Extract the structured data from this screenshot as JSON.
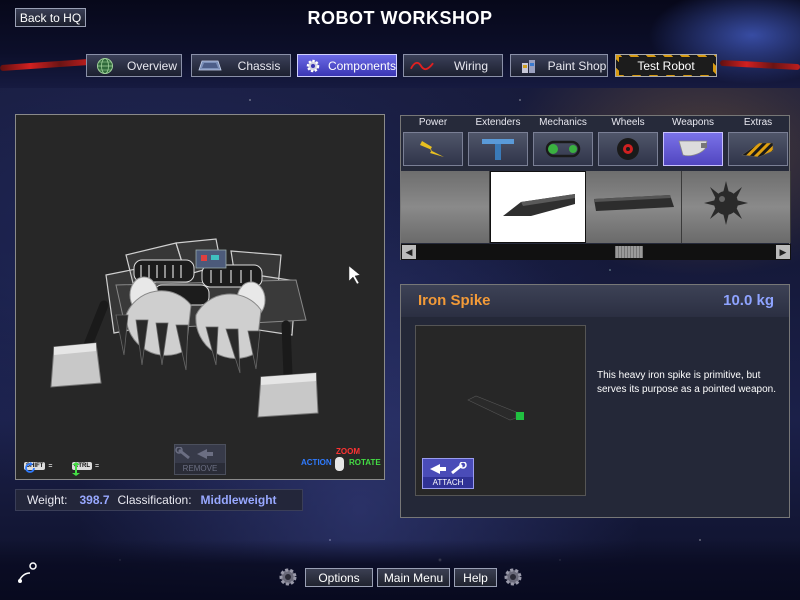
{
  "header": {
    "title": "ROBOT WORKSHOP",
    "back_label": "Back to HQ"
  },
  "tabs": [
    {
      "label": "Overview",
      "icon": "globe-icon",
      "active": false
    },
    {
      "label": "Chassis",
      "icon": "chassis-icon",
      "active": false
    },
    {
      "label": "Components",
      "icon": "gear-icon",
      "active": true
    },
    {
      "label": "Wiring",
      "icon": "wire-icon",
      "active": false
    },
    {
      "label": "Paint Shop",
      "icon": "paint-cans-icon",
      "active": false
    },
    {
      "label": "Test Robot",
      "icon": "none",
      "active": false
    }
  ],
  "viewport": {
    "remove_label": "REMOVE",
    "shift_key": "SHIFT",
    "ctrl_key": "CTRL",
    "equals": "=",
    "zoom_label": "ZOOM",
    "action_label": "ACTION",
    "rotate_label": "ROTATE"
  },
  "stats": {
    "weight_label": "Weight:",
    "weight_value": "398.7",
    "class_label": "Classification:",
    "class_value": "Middleweight"
  },
  "categories": [
    {
      "label": "Power",
      "icon": "lightning-icon"
    },
    {
      "label": "Extenders",
      "icon": "extender-icon"
    },
    {
      "label": "Mechanics",
      "icon": "chain-icon"
    },
    {
      "label": "Wheels",
      "icon": "wheel-icon"
    },
    {
      "label": "Weapons",
      "icon": "blade-icon",
      "active": true
    },
    {
      "label": "Extras",
      "icon": "hazard-icon"
    }
  ],
  "part_items": [
    {
      "name": "item-blank",
      "selected": false
    },
    {
      "name": "item-iron-spike",
      "selected": true
    },
    {
      "name": "item-flat-blade",
      "selected": false
    },
    {
      "name": "item-spiked-ball",
      "selected": false
    }
  ],
  "scroll_position": 0.6,
  "info": {
    "name": "Iron Spike",
    "weight": "10.0 kg",
    "description": "This heavy iron spike is primitive, but serves its purpose as a pointed weapon.",
    "attach_label": "ATTACH"
  },
  "footer": {
    "options": "Options",
    "main_menu": "Main Menu",
    "help": "Help"
  },
  "colors": {
    "accent": "#5146c0",
    "part_name": "#f29a38",
    "weight_value": "#8ea3ff",
    "zoom": "#ff3333",
    "action": "#2f7bff",
    "rotate": "#44dd44"
  }
}
